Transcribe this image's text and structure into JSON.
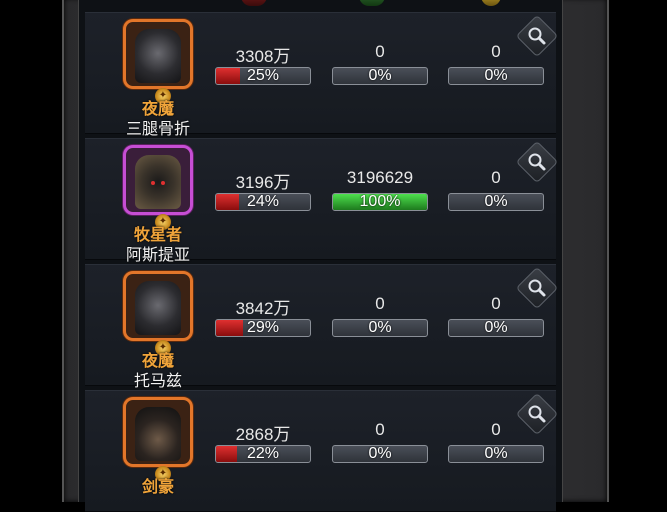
{
  "icons": {
    "header": [
      "red-stat-header-icon",
      "green-stat-header-icon",
      "gold-stat-header-icon"
    ],
    "row": "search-icon"
  },
  "colors": {
    "class_name": "#f0a43a",
    "bar_red": "#e03030",
    "bar_green": "#4de04d",
    "portrait_orange": "#e2762a",
    "portrait_purple": "#c64ed4"
  },
  "rows": [
    {
      "class_name": "夜魔",
      "player_name": "三腿骨折",
      "stat1": "3308万",
      "bar1": "25%",
      "stat2": "0",
      "bar2": "0%",
      "stat3": "0",
      "bar3": "0%"
    },
    {
      "class_name": "牧星者",
      "player_name": "阿斯提亚",
      "stat1": "3196万",
      "bar1": "24%",
      "stat2": "3196629",
      "bar2": "100%",
      "stat3": "0",
      "bar3": "0%"
    },
    {
      "class_name": "夜魔",
      "player_name": "托马兹",
      "stat1": "3842万",
      "bar1": "29%",
      "stat2": "0",
      "bar2": "0%",
      "stat3": "0",
      "bar3": "0%"
    },
    {
      "class_name": "剑豪",
      "player_name": "",
      "stat1": "2868万",
      "bar1": "22%",
      "stat2": "0",
      "bar2": "0%",
      "stat3": "0",
      "bar3": "0%"
    }
  ]
}
